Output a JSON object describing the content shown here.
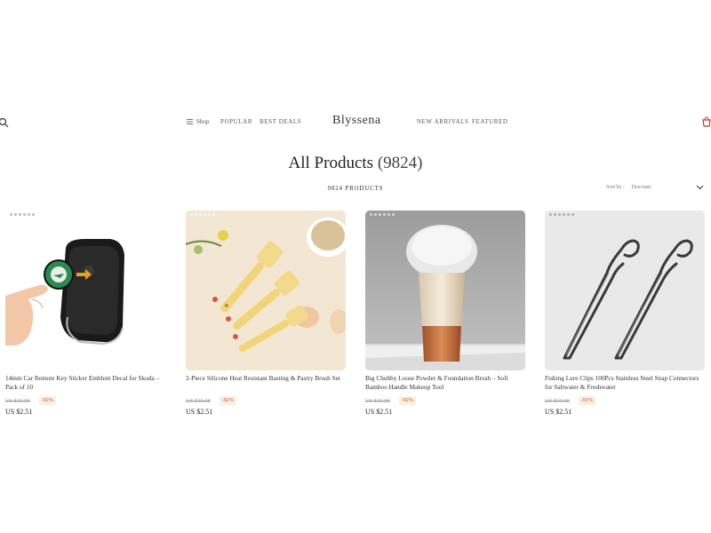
{
  "header": {
    "shop_label": "Shop",
    "nav_left": [
      "POPULAR",
      "BEST DEALS"
    ],
    "brand": "Blyssena",
    "nav_right": [
      "NEW ARRIVALS",
      "FEATURED"
    ]
  },
  "page": {
    "title": "All Products",
    "title_count": "(9824)",
    "result_count": "9824 PRODUCTS",
    "sort_label": "Sort by :",
    "sort_value": "Discount"
  },
  "products": [
    {
      "name": "14mm Car Remote Key Sticker Emblem Decal for Skoda – Pack of 10",
      "old_price": "US $30.98",
      "discount": "-92%",
      "price": "US $2.51"
    },
    {
      "name": "2-Piece Silicone Heat Resistant Basting & Pastry Brush Set",
      "old_price": "US $30.98",
      "discount": "-92%",
      "price": "US $2.51"
    },
    {
      "name": "Big Chubby Loose Powder & Foundation Brush – Soft Bamboo Handle Makeup Tool",
      "old_price": "US $30.98",
      "discount": "-92%",
      "price": "US $2.51"
    },
    {
      "name": "Fishing Lure Clips 100Pcs Stainless Steel Snap Connectors for Saltwater & Freshwater",
      "old_price": "US $30.98",
      "discount": "-91%",
      "price": "US $2.51"
    }
  ],
  "icons": {
    "search": "search-icon",
    "menu": "menu-icon",
    "cart": "cart-icon",
    "sort": "chevron-down-icon"
  },
  "colors": {
    "discount_bg": "#fbeee0",
    "discount_text": "#b05a2a",
    "cart": "#c0392b"
  }
}
